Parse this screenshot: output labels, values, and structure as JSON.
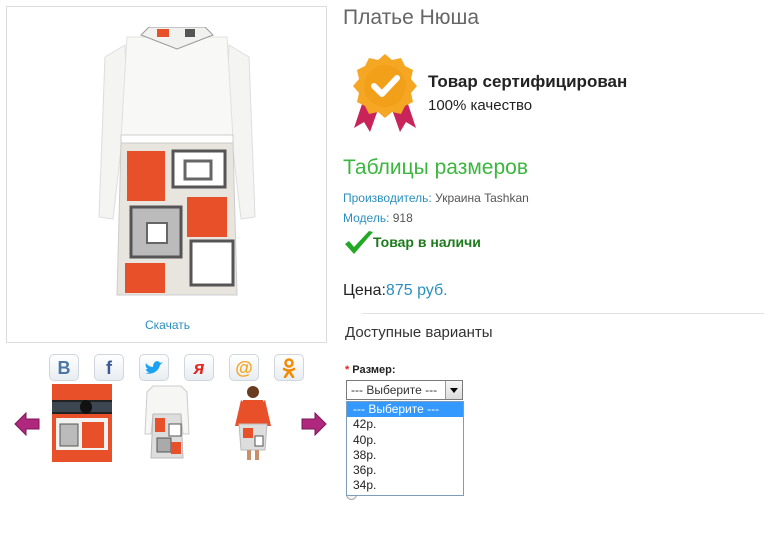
{
  "product": {
    "title": "Платье Нюша",
    "download_label": "Скачать"
  },
  "certificate": {
    "title": "Товар сертифицирован",
    "subtitle": "100% качество"
  },
  "size_table_label": "Таблицы размеров",
  "meta": {
    "manufacturer_key": "Производитель:",
    "manufacturer_value": "Украина Tashkan",
    "model_key": "Модель:",
    "model_value": "918"
  },
  "stock_label": "Товар в наличи",
  "price": {
    "label": "Цена:",
    "value": "875 руб."
  },
  "options": {
    "title": "Доступные варианты",
    "size_label": "Размер:",
    "required_mark": "*",
    "selected": "--- Выберите ---",
    "items": [
      "--- Выберите ---",
      "42р.",
      "40р.",
      "38р.",
      "36р.",
      "34р."
    ]
  },
  "share": [
    {
      "name": "vk",
      "glyph": "В",
      "color": "#4a76a8"
    },
    {
      "name": "facebook",
      "glyph": "f",
      "color": "#3b5998"
    },
    {
      "name": "twitter",
      "glyph": "🐦",
      "color": "#1da1f2"
    },
    {
      "name": "yaru",
      "glyph": "я",
      "color": "#e52620"
    },
    {
      "name": "mailru",
      "glyph": "@",
      "color": "#f5a623"
    },
    {
      "name": "odnoklassniki",
      "glyph": "ок",
      "color": "#f28b00"
    }
  ],
  "colors": {
    "link": "#2a8fbd",
    "green": "#3bb63e",
    "arrow": "#b0287e"
  }
}
